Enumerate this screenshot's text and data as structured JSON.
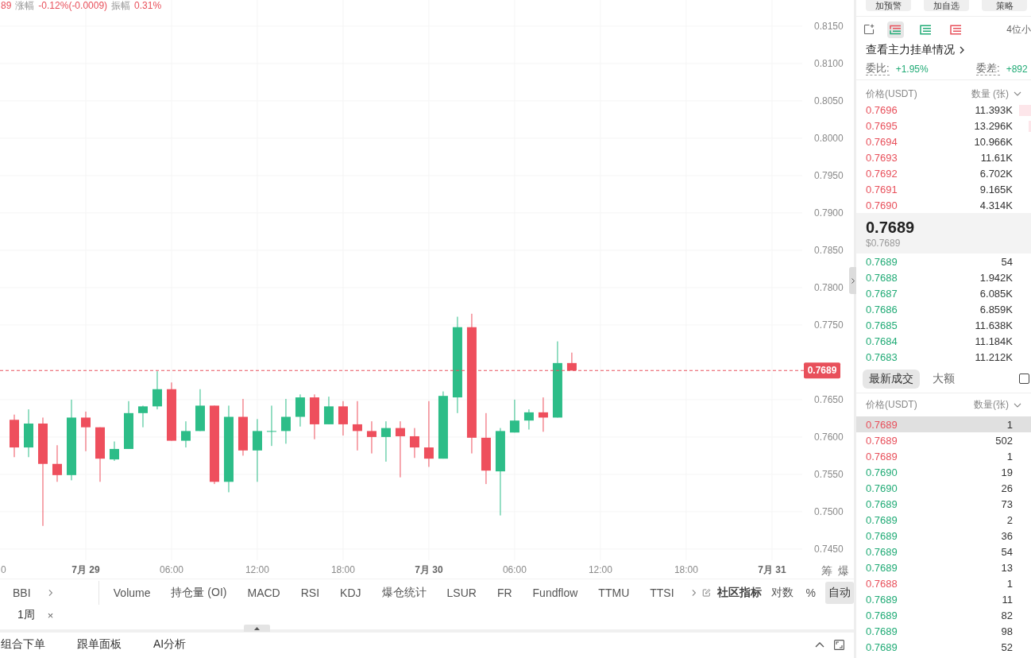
{
  "chart_legend": {
    "price": "89",
    "stats": [
      {
        "label": "涨幅",
        "value": "-0.12%(-0.0009)"
      },
      {
        "label": "振幅",
        "value": "0.31%"
      }
    ]
  },
  "chart": {
    "chart_data": [
      {
        "type": "candlestick",
        "x": [
          "--07-28T19:00",
          "--07-28T20:00",
          "--07-28T21:00",
          "--07-28T22:00",
          "--07-28T23:00",
          "--07-29T00:00",
          "--07-29T01:00",
          "--07-29T02:00",
          "--07-29T03:00",
          "--07-29T04:00",
          "--07-29T05:00",
          "--07-29T06:00",
          "--07-29T07:00",
          "--07-29T08:00",
          "--07-29T09:00",
          "--07-29T10:00",
          "--07-29T11:00",
          "--07-29T12:00",
          "--07-29T13:00",
          "--07-29T14:00",
          "--07-29T15:00",
          "--07-29T16:00",
          "--07-29T17:00",
          "--07-29T18:00",
          "--07-29T19:00",
          "--07-29T20:00",
          "--07-29T21:00",
          "--07-29T22:00",
          "--07-29T23:00",
          "--07-30T00:00",
          "--07-30T01:00",
          "--07-30T02:00",
          "--07-30T03:00",
          "--07-30T04:00",
          "--07-30T05:00",
          "--07-30T06:00",
          "--07-30T07:00",
          "--07-30T08:00",
          "--07-30T09:00",
          "--07-30T10:00"
        ],
        "ohlc": [
          [
            0.7623,
            0.763,
            0.7573,
            0.7586
          ],
          [
            0.7586,
            0.7637,
            0.7573,
            0.7618
          ],
          [
            0.7618,
            0.7626,
            0.7481,
            0.7564
          ],
          [
            0.7564,
            0.7589,
            0.754,
            0.7549
          ],
          [
            0.7549,
            0.765,
            0.7542,
            0.7626
          ],
          [
            0.7626,
            0.7634,
            0.7581,
            0.7613
          ],
          [
            0.7613,
            0.7613,
            0.754,
            0.7571
          ],
          [
            0.757,
            0.7594,
            0.7568,
            0.7584
          ],
          [
            0.7584,
            0.7648,
            0.7584,
            0.7632
          ],
          [
            0.7632,
            0.7642,
            0.7613,
            0.7641
          ],
          [
            0.7641,
            0.7688,
            0.7637,
            0.7664
          ],
          [
            0.7664,
            0.7673,
            0.7595,
            0.7595
          ],
          [
            0.7595,
            0.7621,
            0.7586,
            0.7608
          ],
          [
            0.7608,
            0.7664,
            0.7608,
            0.7642
          ],
          [
            0.7642,
            0.7642,
            0.7537,
            0.754
          ],
          [
            0.754,
            0.7642,
            0.7526,
            0.7627
          ],
          [
            0.7627,
            0.7651,
            0.7575,
            0.7582
          ],
          [
            0.7582,
            0.7624,
            0.754,
            0.7608
          ],
          [
            0.7608,
            0.7642,
            0.7588,
            0.7608
          ],
          [
            0.7608,
            0.7651,
            0.7591,
            0.7627
          ],
          [
            0.7627,
            0.7657,
            0.7614,
            0.7653
          ],
          [
            0.7653,
            0.7657,
            0.7597,
            0.7617
          ],
          [
            0.7617,
            0.7654,
            0.7617,
            0.7641
          ],
          [
            0.7641,
            0.7648,
            0.7602,
            0.7617
          ],
          [
            0.7617,
            0.7648,
            0.7582,
            0.7608
          ],
          [
            0.7608,
            0.7621,
            0.7578,
            0.76
          ],
          [
            0.76,
            0.7621,
            0.7567,
            0.7612
          ],
          [
            0.7612,
            0.7621,
            0.7546,
            0.7601
          ],
          [
            0.7601,
            0.7612,
            0.7572,
            0.7586
          ],
          [
            0.7586,
            0.7648,
            0.756,
            0.7571
          ],
          [
            0.7571,
            0.7661,
            0.7571,
            0.7655
          ],
          [
            0.7653,
            0.7761,
            0.7632,
            0.7747
          ],
          [
            0.7747,
            0.7765,
            0.7578,
            0.7599
          ],
          [
            0.7599,
            0.7632,
            0.7537,
            0.7555
          ],
          [
            0.7554,
            0.7612,
            0.7495,
            0.7608
          ],
          [
            0.7606,
            0.765,
            0.7606,
            0.7622
          ],
          [
            0.7622,
            0.7637,
            0.761,
            0.7633
          ],
          [
            0.7633,
            0.7653,
            0.7607,
            0.7626
          ],
          [
            0.7626,
            0.7728,
            0.7626,
            0.7699
          ],
          [
            0.7699,
            0.7713,
            0.7689,
            0.7689
          ]
        ],
        "xlim": [
          "--07-28T18:00",
          "--07-31T02:07"
        ],
        "ylim": [
          0.7435,
          0.8185
        ],
        "xticks": [
          {
            "value": "--07-28T18:00",
            "label": "0"
          },
          {
            "value": "--07-29T00:00",
            "label": "7月 29"
          },
          {
            "value": "--07-29T06:00",
            "label": "06:00"
          },
          {
            "value": "--07-29T12:00",
            "label": "12:00"
          },
          {
            "value": "--07-29T18:00",
            "label": "18:00"
          },
          {
            "value": "--07-30T00:00",
            "label": "7月 30"
          },
          {
            "value": "--07-30T06:00",
            "label": "06:00"
          },
          {
            "value": "--07-30T12:00",
            "label": "12:00"
          },
          {
            "value": "--07-30T18:00",
            "label": "18:00"
          },
          {
            "value": "--07-31T00:00",
            "label": "7月 31"
          }
        ],
        "yticks": [
          {
            "value": 0.745,
            "label": "0.7450"
          },
          {
            "value": 0.75,
            "label": "0.7500"
          },
          {
            "value": 0.755,
            "label": "0.7550"
          },
          {
            "value": 0.76,
            "label": "0.7600"
          },
          {
            "value": 0.765,
            "label": "0.7650"
          },
          {
            "value": 0.775,
            "label": "0.7750"
          },
          {
            "value": 0.78,
            "label": "0.7800"
          },
          {
            "value": 0.785,
            "label": "0.7850"
          },
          {
            "value": 0.79,
            "label": "0.7900"
          },
          {
            "value": 0.795,
            "label": "0.7950"
          },
          {
            "value": 0.8,
            "label": "0.8000"
          },
          {
            "value": 0.805,
            "label": "0.8050"
          },
          {
            "value": 0.81,
            "label": "0.8100"
          },
          {
            "value": 0.815,
            "label": "0.8150"
          }
        ],
        "grid": true,
        "ref_lines": [
          {
            "axis": "y",
            "value": 0.7689,
            "label": "0.7689",
            "color": "#e8505b",
            "line_style": "dashed"
          }
        ]
      }
    ],
    "side_buttons": [
      "筹",
      "爆"
    ]
  },
  "indicator_bar": {
    "main": [
      "BBI"
    ],
    "sub": [
      "Volume",
      "持仓量 (OI)",
      "MACD",
      "RSI",
      "KDJ",
      "爆仓统计",
      "LSUR",
      "FR",
      "Fundflow",
      "TTMU",
      "TTSI"
    ],
    "community": "社区指标",
    "scale_options": [
      {
        "label": "对数",
        "selected": false
      },
      {
        "label": "%",
        "selected": false
      },
      {
        "label": "自动",
        "selected": true
      }
    ]
  },
  "interval_tags": [
    {
      "label": "1周",
      "close": "×"
    }
  ],
  "bottom_tabs": [
    "组合下单",
    "跟单面板",
    "AI分析"
  ],
  "order_book": {
    "actions": [
      "加预警",
      "加自选",
      "策略"
    ],
    "view_modes": [
      {
        "kind": "both",
        "selected": true
      },
      {
        "kind": "bids",
        "selected": false
      },
      {
        "kind": "asks",
        "selected": false
      }
    ],
    "precision": "4位小",
    "main_orders_link": "查看主力挂单情况",
    "ratio": {
      "label": "委比:",
      "value": "+1.95%"
    },
    "delta": {
      "label": "委差:",
      "value": "+892"
    },
    "columns": [
      "价格(USDT)",
      "数量 (张)"
    ],
    "asks": [
      {
        "price": "0.7696",
        "amount": "11.393K",
        "level": 0.07
      },
      {
        "price": "0.7695",
        "amount": "13.296K",
        "level": 0.012
      },
      {
        "price": "0.7694",
        "amount": "10.966K"
      },
      {
        "price": "0.7693",
        "amount": "11.61K"
      },
      {
        "price": "0.7692",
        "amount": "6.702K"
      },
      {
        "price": "0.7691",
        "amount": "9.165K"
      },
      {
        "price": "0.7690",
        "amount": "4.314K"
      }
    ],
    "last_price": "0.7689",
    "last_price_usd": "$0.7689",
    "bids": [
      {
        "price": "0.7689",
        "amount": "54"
      },
      {
        "price": "0.7688",
        "amount": "1.942K"
      },
      {
        "price": "0.7687",
        "amount": "6.085K"
      },
      {
        "price": "0.7686",
        "amount": "6.859K"
      },
      {
        "price": "0.7685",
        "amount": "11.638K"
      },
      {
        "price": "0.7684",
        "amount": "11.184K"
      },
      {
        "price": "0.7683",
        "amount": "11.212K"
      }
    ]
  },
  "trades": {
    "tabs": [
      {
        "label": "最新成交",
        "selected": true
      },
      {
        "label": "大额",
        "selected": false
      }
    ],
    "filter_checked": false,
    "columns": [
      "价格(USDT)",
      "数量(张)"
    ],
    "rows": [
      {
        "price": "0.7689",
        "amount": "1",
        "color": "#e8505b",
        "highlighted": true
      },
      {
        "price": "0.7689",
        "amount": "502",
        "color": "#e8505b",
        "highlighted": false
      },
      {
        "price": "0.7689",
        "amount": "1",
        "color": "#e8505b",
        "highlighted": false
      },
      {
        "price": "0.7690",
        "amount": "19",
        "color": "#21ab76",
        "highlighted": false
      },
      {
        "price": "0.7690",
        "amount": "26",
        "color": "#21ab76",
        "highlighted": false
      },
      {
        "price": "0.7689",
        "amount": "73",
        "color": "#21ab76",
        "highlighted": false
      },
      {
        "price": "0.7689",
        "amount": "2",
        "color": "#21ab76",
        "highlighted": false
      },
      {
        "price": "0.7689",
        "amount": "36",
        "color": "#21ab76",
        "highlighted": false
      },
      {
        "price": "0.7689",
        "amount": "54",
        "color": "#21ab76",
        "highlighted": false
      },
      {
        "price": "0.7689",
        "amount": "13",
        "color": "#21ab76",
        "highlighted": false
      },
      {
        "price": "0.7688",
        "amount": "1",
        "color": "#e8505b",
        "highlighted": false
      },
      {
        "price": "0.7689",
        "amount": "11",
        "color": "#21ab76",
        "highlighted": false
      },
      {
        "price": "0.7689",
        "amount": "82",
        "color": "#21ab76",
        "highlighted": false
      },
      {
        "price": "0.7689",
        "amount": "98",
        "color": "#21ab76",
        "highlighted": false
      },
      {
        "price": "0.7689",
        "amount": "52",
        "color": "#21ab76",
        "highlighted": false
      }
    ]
  }
}
